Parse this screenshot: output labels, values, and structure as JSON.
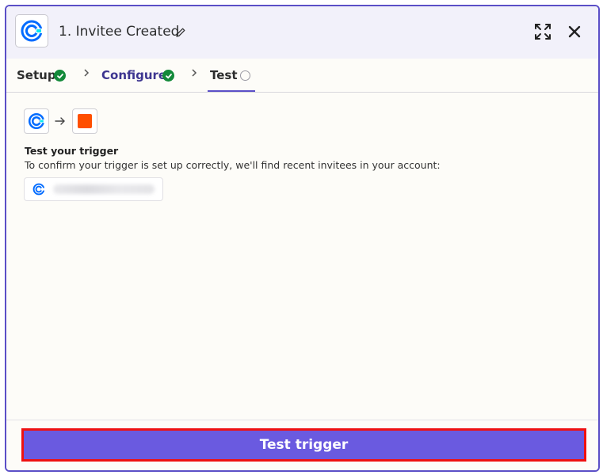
{
  "header": {
    "title": "1. Invitee Created"
  },
  "tabs": [
    {
      "label": "Setup",
      "status": "complete"
    },
    {
      "label": "Configure",
      "status": "complete"
    },
    {
      "label": "Test",
      "status": "active"
    }
  ],
  "section": {
    "title": "Test your trigger",
    "description": "To confirm your trigger is set up correctly, we'll find recent invitees in your account:"
  },
  "footer": {
    "button_label": "Test trigger"
  },
  "colors": {
    "accent": "#6a5ae0",
    "border": "#5b4fc7",
    "success": "#138a3a",
    "calendly": "#006bff",
    "zapier": "#ff4f00",
    "highlight": "#ee1111"
  },
  "icons": {
    "app": "calendly-logo-icon",
    "edit": "pencil-icon",
    "expand": "expand-icon",
    "close": "close-icon",
    "check": "check-circle-icon",
    "chevron": "chevron-right-icon",
    "pending": "empty-circle-icon",
    "target": "zapier-square-icon",
    "arrow": "arrow-right-icon"
  }
}
